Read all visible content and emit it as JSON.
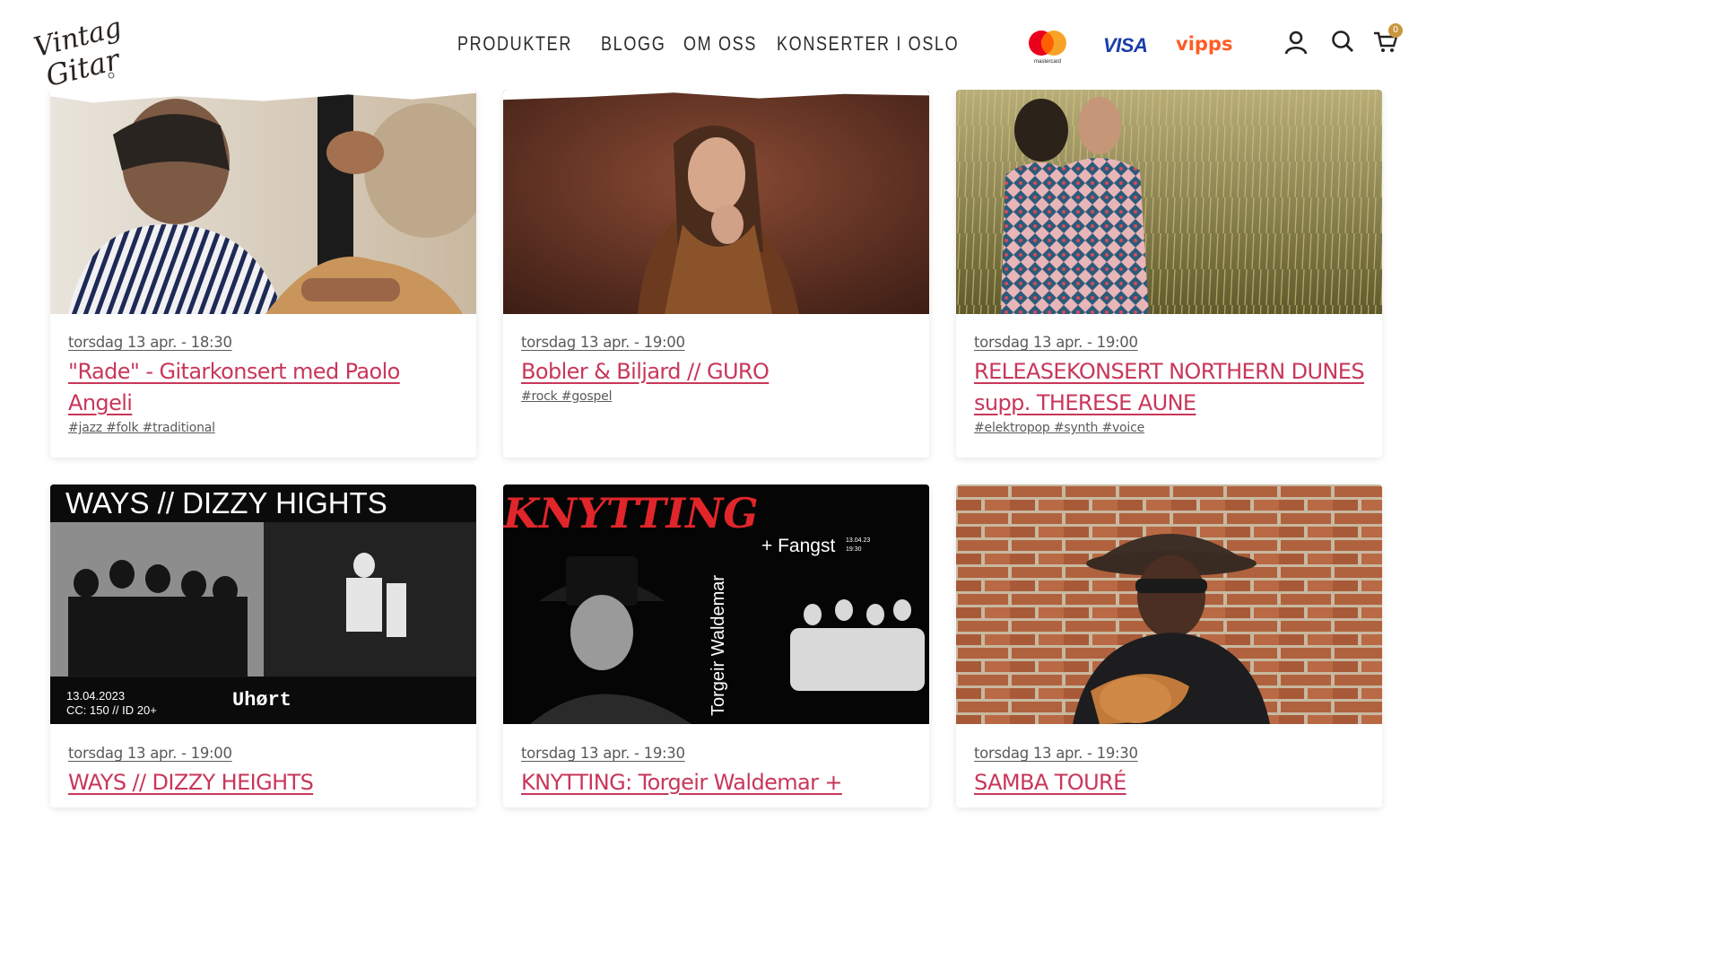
{
  "header": {
    "logo_text": [
      "Vintage",
      "Gitar"
    ],
    "nav": [
      "PRODUKTER",
      "BLOGG",
      "OM OSS",
      "KONSERTER I OSLO"
    ],
    "payments": {
      "mastercard_text": "mastercard",
      "visa": "VISA",
      "vipps": "vipps"
    },
    "cart_count": "0",
    "icons": [
      "user-icon",
      "search-icon",
      "cart-icon"
    ]
  },
  "events": [
    {
      "date": "torsdag 13 apr. - 18:30",
      "title": "\"Rade\" - Gitarkonsert med Paolo Angeli",
      "tags": "#jazz #folk #traditional"
    },
    {
      "date": "torsdag 13 apr. - 19:00",
      "title": "Bobler & Biljard // GURO",
      "tags": "#rock #gospel"
    },
    {
      "date": "torsdag 13 apr. - 19:00",
      "title": "RELEASEKONSERT NORTHERN DUNES supp. THERESE AUNE",
      "tags": "#elektropop #synth #voice"
    },
    {
      "date": "torsdag 13 apr. - 19:00",
      "title": "WAYS // DIZZY HEIGHTS",
      "tags": ""
    },
    {
      "date": "torsdag 13 apr. - 19:30",
      "title": "KNYTTING: Torgeir Waldemar +",
      "tags": ""
    },
    {
      "date": "torsdag 13 apr. - 19:30",
      "title": "SAMBA TOURÉ",
      "tags": ""
    }
  ],
  "posters": {
    "ways": {
      "headline": "WAYS // DIZZY HIGHTS",
      "date": "13.04.2023",
      "info": "CC: 150 // ID 20+",
      "venue": "Uhørt"
    },
    "knytting": {
      "headline": "KNYTTING",
      "artist": "Torgeir Waldemar",
      "support": "+ Fangst",
      "small_date": "13.04.23",
      "small_time": "19:30"
    }
  },
  "colors": {
    "accent": "#c8375a",
    "text": "#333333",
    "badge": "#c9953e"
  }
}
